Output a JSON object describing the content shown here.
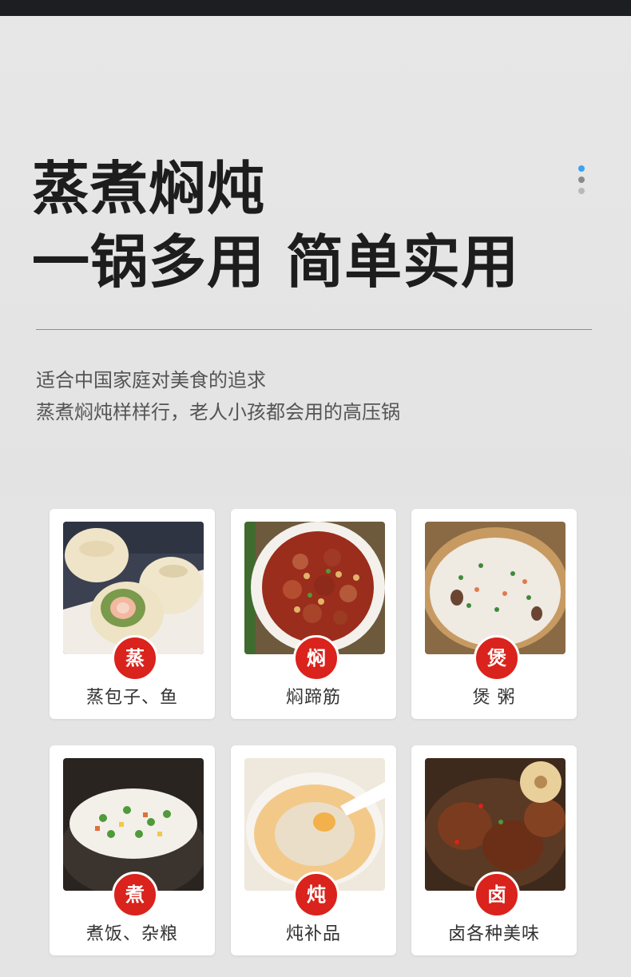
{
  "headline": {
    "line1": "蒸煮焖炖",
    "line2": "一锅多用  简单实用"
  },
  "subtitle": {
    "line1": "适合中国家庭对美食的追求",
    "line2": "蒸煮焖炖样样行，老人小孩都会用的高压锅"
  },
  "carousel": {
    "dot_count": 3,
    "active_index": 0,
    "active_color": "#3aa3f2"
  },
  "accent_color": "#d9231c",
  "cards": [
    {
      "badge": "蒸",
      "label": "蒸包子、鱼",
      "photo": "steamed-buns"
    },
    {
      "badge": "焖",
      "label": "焖蹄筋",
      "photo": "braised-tendon"
    },
    {
      "badge": "煲",
      "label": "煲 粥",
      "photo": "congee-pot"
    },
    {
      "badge": "煮",
      "label": "煮饭、杂粮",
      "photo": "rice-with-peas"
    },
    {
      "badge": "炖",
      "label": "炖补品",
      "photo": "bird-nest-soup"
    },
    {
      "badge": "卤",
      "label": "卤各种美味",
      "photo": "braised-trotters"
    }
  ]
}
